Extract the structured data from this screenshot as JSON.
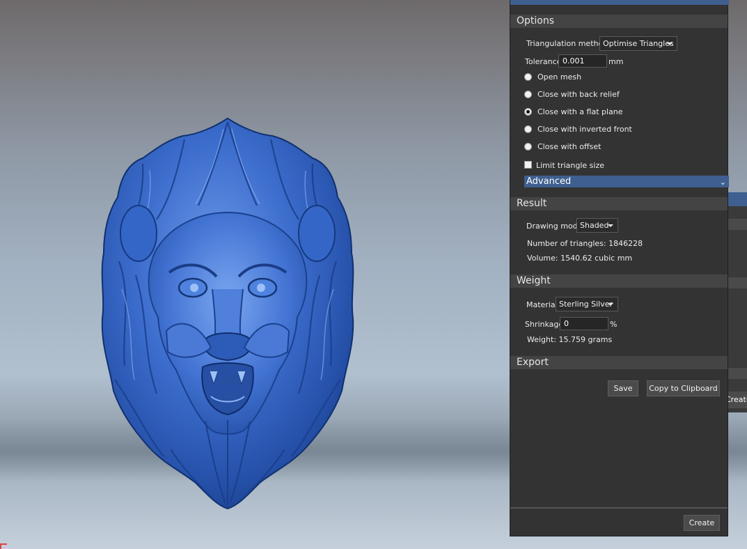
{
  "options": {
    "section_title": "Options",
    "triangulation_label": "Triangulation method",
    "triangulation_value": "Optimise Triangles",
    "tolerance_label": "Tolerance",
    "tolerance_value": "0.001",
    "tolerance_unit": "mm",
    "radios": [
      {
        "label": "Open mesh",
        "checked": false
      },
      {
        "label": "Close with back relief",
        "checked": false
      },
      {
        "label": "Close with a flat plane",
        "checked": true
      },
      {
        "label": "Close with inverted front",
        "checked": false
      },
      {
        "label": "Close with offset",
        "checked": false
      }
    ],
    "limit_label": "Limit triangle size",
    "limit_checked": false,
    "advanced_label": "Advanced"
  },
  "result": {
    "section_title": "Result",
    "drawing_mode_label": "Drawing mode",
    "drawing_mode_value": "Shaded",
    "triangles_text": "Number of triangles: 1846228",
    "volume_text": "Volume: 1540.62 cubic mm"
  },
  "weight": {
    "section_title": "Weight",
    "material_label": "Material",
    "material_value": "Sterling Silver",
    "shrinkage_label": "Shrinkage",
    "shrinkage_value": "0",
    "shrinkage_unit": "%",
    "weight_text": "Weight: 15.759 grams"
  },
  "export": {
    "section_title": "Export",
    "save_label": "Save",
    "copy_label": "Copy to Clipboard"
  },
  "footer": {
    "create_label": "Create"
  },
  "back_dialog": {
    "button_label": "Create B"
  },
  "colors": {
    "accent": "#3e5f8f",
    "panel_bg": "#333333",
    "section_header_bg": "#444444",
    "model_blue": "#2f62c4"
  }
}
